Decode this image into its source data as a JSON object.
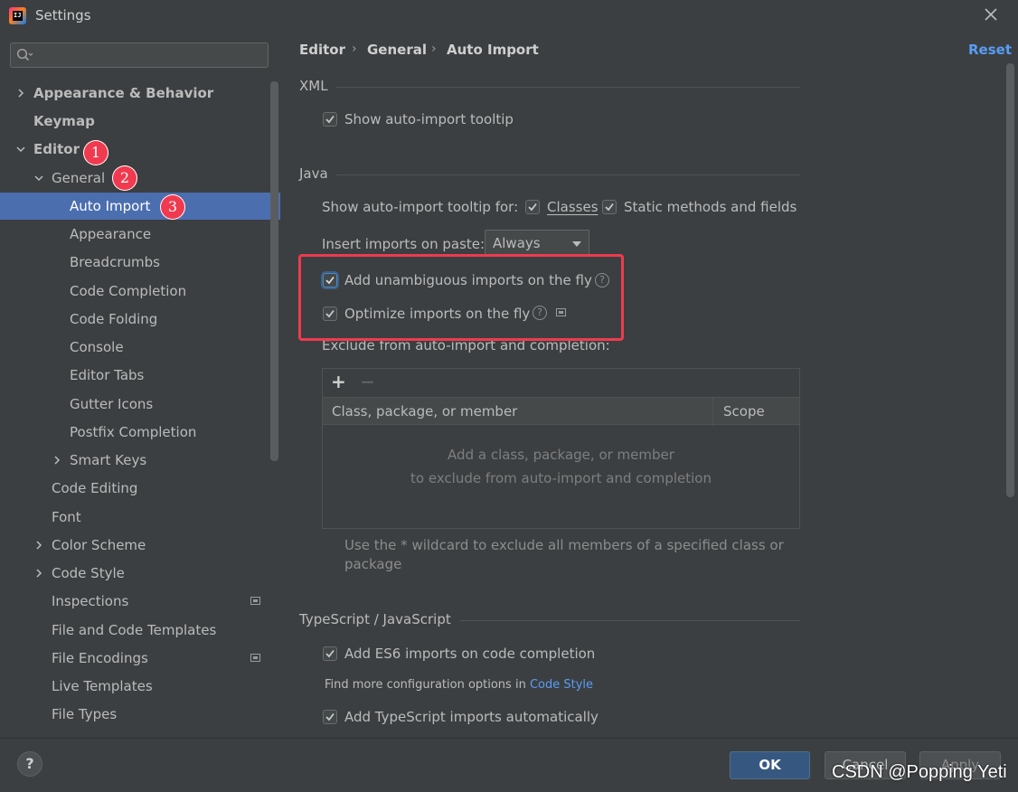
{
  "window": {
    "title": "Settings",
    "app_icon_text": "IJ"
  },
  "sidebar": {
    "search_placeholder": "",
    "items": [
      {
        "label": "Appearance & Behavior"
      },
      {
        "label": "Keymap"
      },
      {
        "label": "Editor"
      },
      {
        "label": "General"
      },
      {
        "label": "Auto Import"
      },
      {
        "label": "Appearance"
      },
      {
        "label": "Breadcrumbs"
      },
      {
        "label": "Code Completion"
      },
      {
        "label": "Code Folding"
      },
      {
        "label": "Console"
      },
      {
        "label": "Editor Tabs"
      },
      {
        "label": "Gutter Icons"
      },
      {
        "label": "Postfix Completion"
      },
      {
        "label": "Smart Keys"
      },
      {
        "label": "Code Editing"
      },
      {
        "label": "Font"
      },
      {
        "label": "Color Scheme"
      },
      {
        "label": "Code Style"
      },
      {
        "label": "Inspections"
      },
      {
        "label": "File and Code Templates"
      },
      {
        "label": "File Encodings"
      },
      {
        "label": "Live Templates"
      },
      {
        "label": "File Types"
      }
    ],
    "selected": "Auto Import"
  },
  "annotations": {
    "badge1": "1",
    "badge2": "2",
    "badge3": "3",
    "color": "#f03a4f"
  },
  "breadcrumb": {
    "part1": "Editor",
    "part2": "General",
    "part3": "Auto Import",
    "separator": "›"
  },
  "reset_label": "Reset",
  "xml": {
    "section_title": "XML",
    "show_tooltip": {
      "label": "Show auto-import tooltip",
      "checked": true
    }
  },
  "java": {
    "section_title": "Java",
    "tooltip_for_label": "Show auto-import tooltip for:",
    "classes": {
      "label": "Classes",
      "checked": true
    },
    "static_methods": {
      "label": "Static methods and fields",
      "checked": true
    },
    "insert_on_paste_label": "Insert imports on paste:",
    "insert_on_paste_value": "Always",
    "add_unambiguous": {
      "label": "Add unambiguous imports on the fly",
      "checked": true
    },
    "optimize_imports": {
      "label": "Optimize imports on the fly",
      "checked": true
    },
    "exclude_label": "Exclude from auto-import and completion:",
    "table": {
      "add_symbol": "+",
      "remove_symbol": "−",
      "columns": [
        "Class, package, or member",
        "Scope"
      ],
      "empty_line1": "Add a class, package, or member",
      "empty_line2": "to exclude from auto-import and completion"
    },
    "wildcard_hint_line1": "Use the * wildcard to exclude all members of a specified class or",
    "wildcard_hint_line2": "package"
  },
  "typescript": {
    "section_title": "TypeScript / JavaScript",
    "es6_imports": {
      "label": "Add ES6 imports on code completion",
      "checked": true
    },
    "more_options_text": "Find more configuration options in",
    "more_options_link": "Code Style",
    "ts_imports": {
      "label": "Add TypeScript imports automatically",
      "checked": true
    }
  },
  "footer": {
    "help": "?",
    "ok": "OK",
    "cancel": "Cancel",
    "apply": "Apply"
  },
  "watermark": "CSDN @Popping Yeti",
  "colors": {
    "accent": "#4b6eaf",
    "link": "#589df6",
    "background": "#3c3f41"
  }
}
